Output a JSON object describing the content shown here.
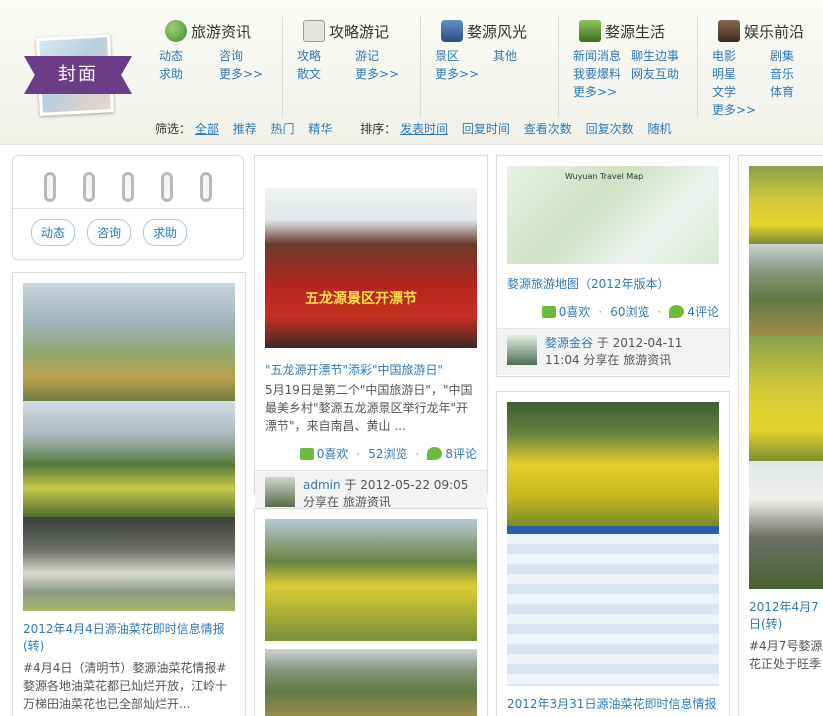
{
  "logo": {
    "label": "封面"
  },
  "nav": [
    {
      "title": "旅游资讯",
      "icon": "globe-icon",
      "color": "#4f9a3b",
      "links": [
        "动态",
        "咨询",
        "求助",
        "更多>>"
      ]
    },
    {
      "title": "攻略游记",
      "icon": "notebook-icon",
      "color": "#8c8c8c",
      "links": [
        "攻略",
        "游记",
        "散文",
        "更多>>"
      ]
    },
    {
      "title": "婺源风光",
      "icon": "camera-icon",
      "color": "#3e6fa8",
      "links": [
        "景区",
        "其他",
        "更多>>"
      ]
    },
    {
      "title": "婺源生活",
      "icon": "leaf-icon",
      "color": "#5b8f2e",
      "links": [
        "新闻消息",
        "聊生边事",
        "我要爆料",
        "网友互助",
        "更多>>"
      ]
    },
    {
      "title": "娱乐前沿",
      "icon": "music-icon",
      "color": "#6a4a2c",
      "links": [
        "电影",
        "剧集",
        "明星",
        "音乐",
        "文学",
        "体育",
        "更多>>"
      ]
    }
  ],
  "filter": {
    "label": "筛选：",
    "options": [
      "全部",
      "推荐",
      "热门",
      "精华"
    ],
    "active": "全部",
    "sort_label": "排序：",
    "sort_options": [
      "发表时间",
      "回复时间",
      "查看次数",
      "回复次数",
      "随机"
    ],
    "sort_active": "发表时间"
  },
  "binder": {
    "pills": [
      "动态",
      "咨询",
      "求助"
    ]
  },
  "cards": {
    "rapeseed_info": {
      "title": "2012年4月4日源油菜花即时信息情报(转)",
      "desc": "#4月4日（清明节）婺源油菜花情报# 婺源各地油菜花都已灿烂开放，江岭十万梯田油菜花也已全部灿烂开..."
    },
    "festival": {
      "title": "\"五龙源开漂节\"添彩\"中国旅游日\"",
      "desc": "5月19日是第二个\"中国旅游日\"，\"中国最美乡村\"婺源五龙源景区举行龙年\"开漂节\"，来自南昌、黄山 ...",
      "likes": "0喜欢",
      "views": "52浏览",
      "comments": "8评论",
      "user": "admin",
      "meta": "于 2012-05-22 09:05 分享在 旅游资讯",
      "banner": "五龙源景区开漂节"
    },
    "map": {
      "title": "婺源旅游地图（2012年版本）",
      "likes": "0喜欢",
      "views": "60浏览",
      "comments": "4评论",
      "user": "婺源金谷",
      "meta": "于 2012-04-11 11:04 分享在 旅游资讯",
      "map_caption": "Wuyuan Travel Map"
    },
    "weather": {
      "title": "2012年3月31日源油菜花即时信息情报"
    },
    "right_partial": {
      "title": "2012年4月7日(转)",
      "desc": "#4月7号婺源花正处于旺季"
    }
  },
  "colors": {
    "link": "#2f7ab5",
    "accent_green": "#6dbb3a",
    "ribbon": "#6a3d86"
  }
}
